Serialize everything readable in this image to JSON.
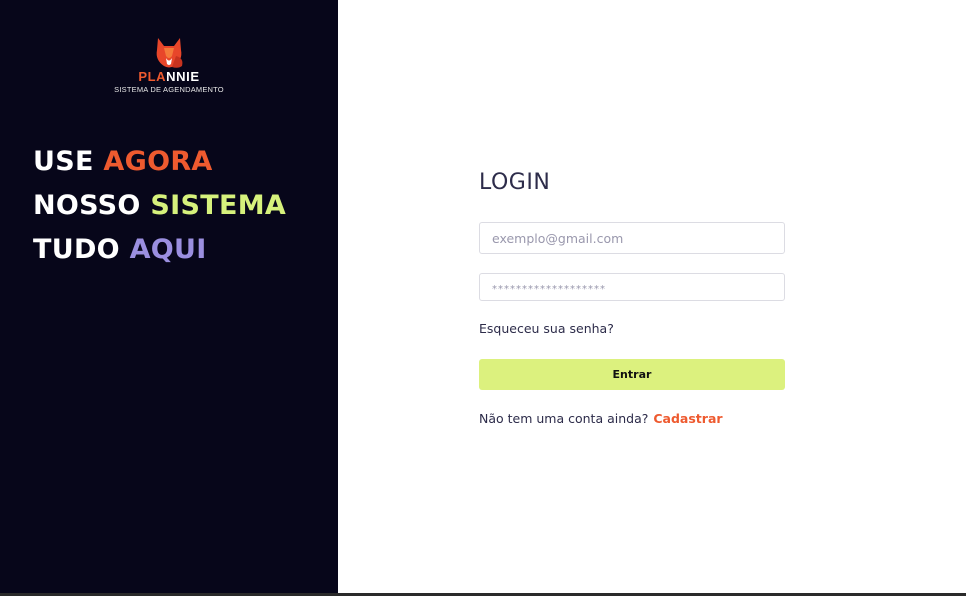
{
  "brand": {
    "name_part1": "PLA",
    "name_part2": "NNIE",
    "subtitle": "SISTEMA DE AGENDAMENTO",
    "logo_icon": "fox-icon",
    "accent": "#ee5a2f"
  },
  "headline": {
    "line1": [
      "USE ",
      "AGORA"
    ],
    "line2": [
      "NOSSO ",
      "SISTEMA"
    ],
    "line3": [
      "TUDO ",
      "AQUI"
    ],
    "colors": {
      "orange": "#ee5a2f",
      "lime": "#d6f17c",
      "purple": "#9b8fe0"
    }
  },
  "login": {
    "title": "LOGIN",
    "email_placeholder": "exemplo@gmail.com",
    "email_value": "",
    "password_placeholder": "*******************",
    "password_value": "",
    "forgot_label": "Esqueceu sua senha?",
    "submit_label": "Entrar",
    "signup_prompt": "Não tem uma conta ainda?",
    "signup_link": "Cadastrar",
    "button_color": "#dcf17e"
  }
}
